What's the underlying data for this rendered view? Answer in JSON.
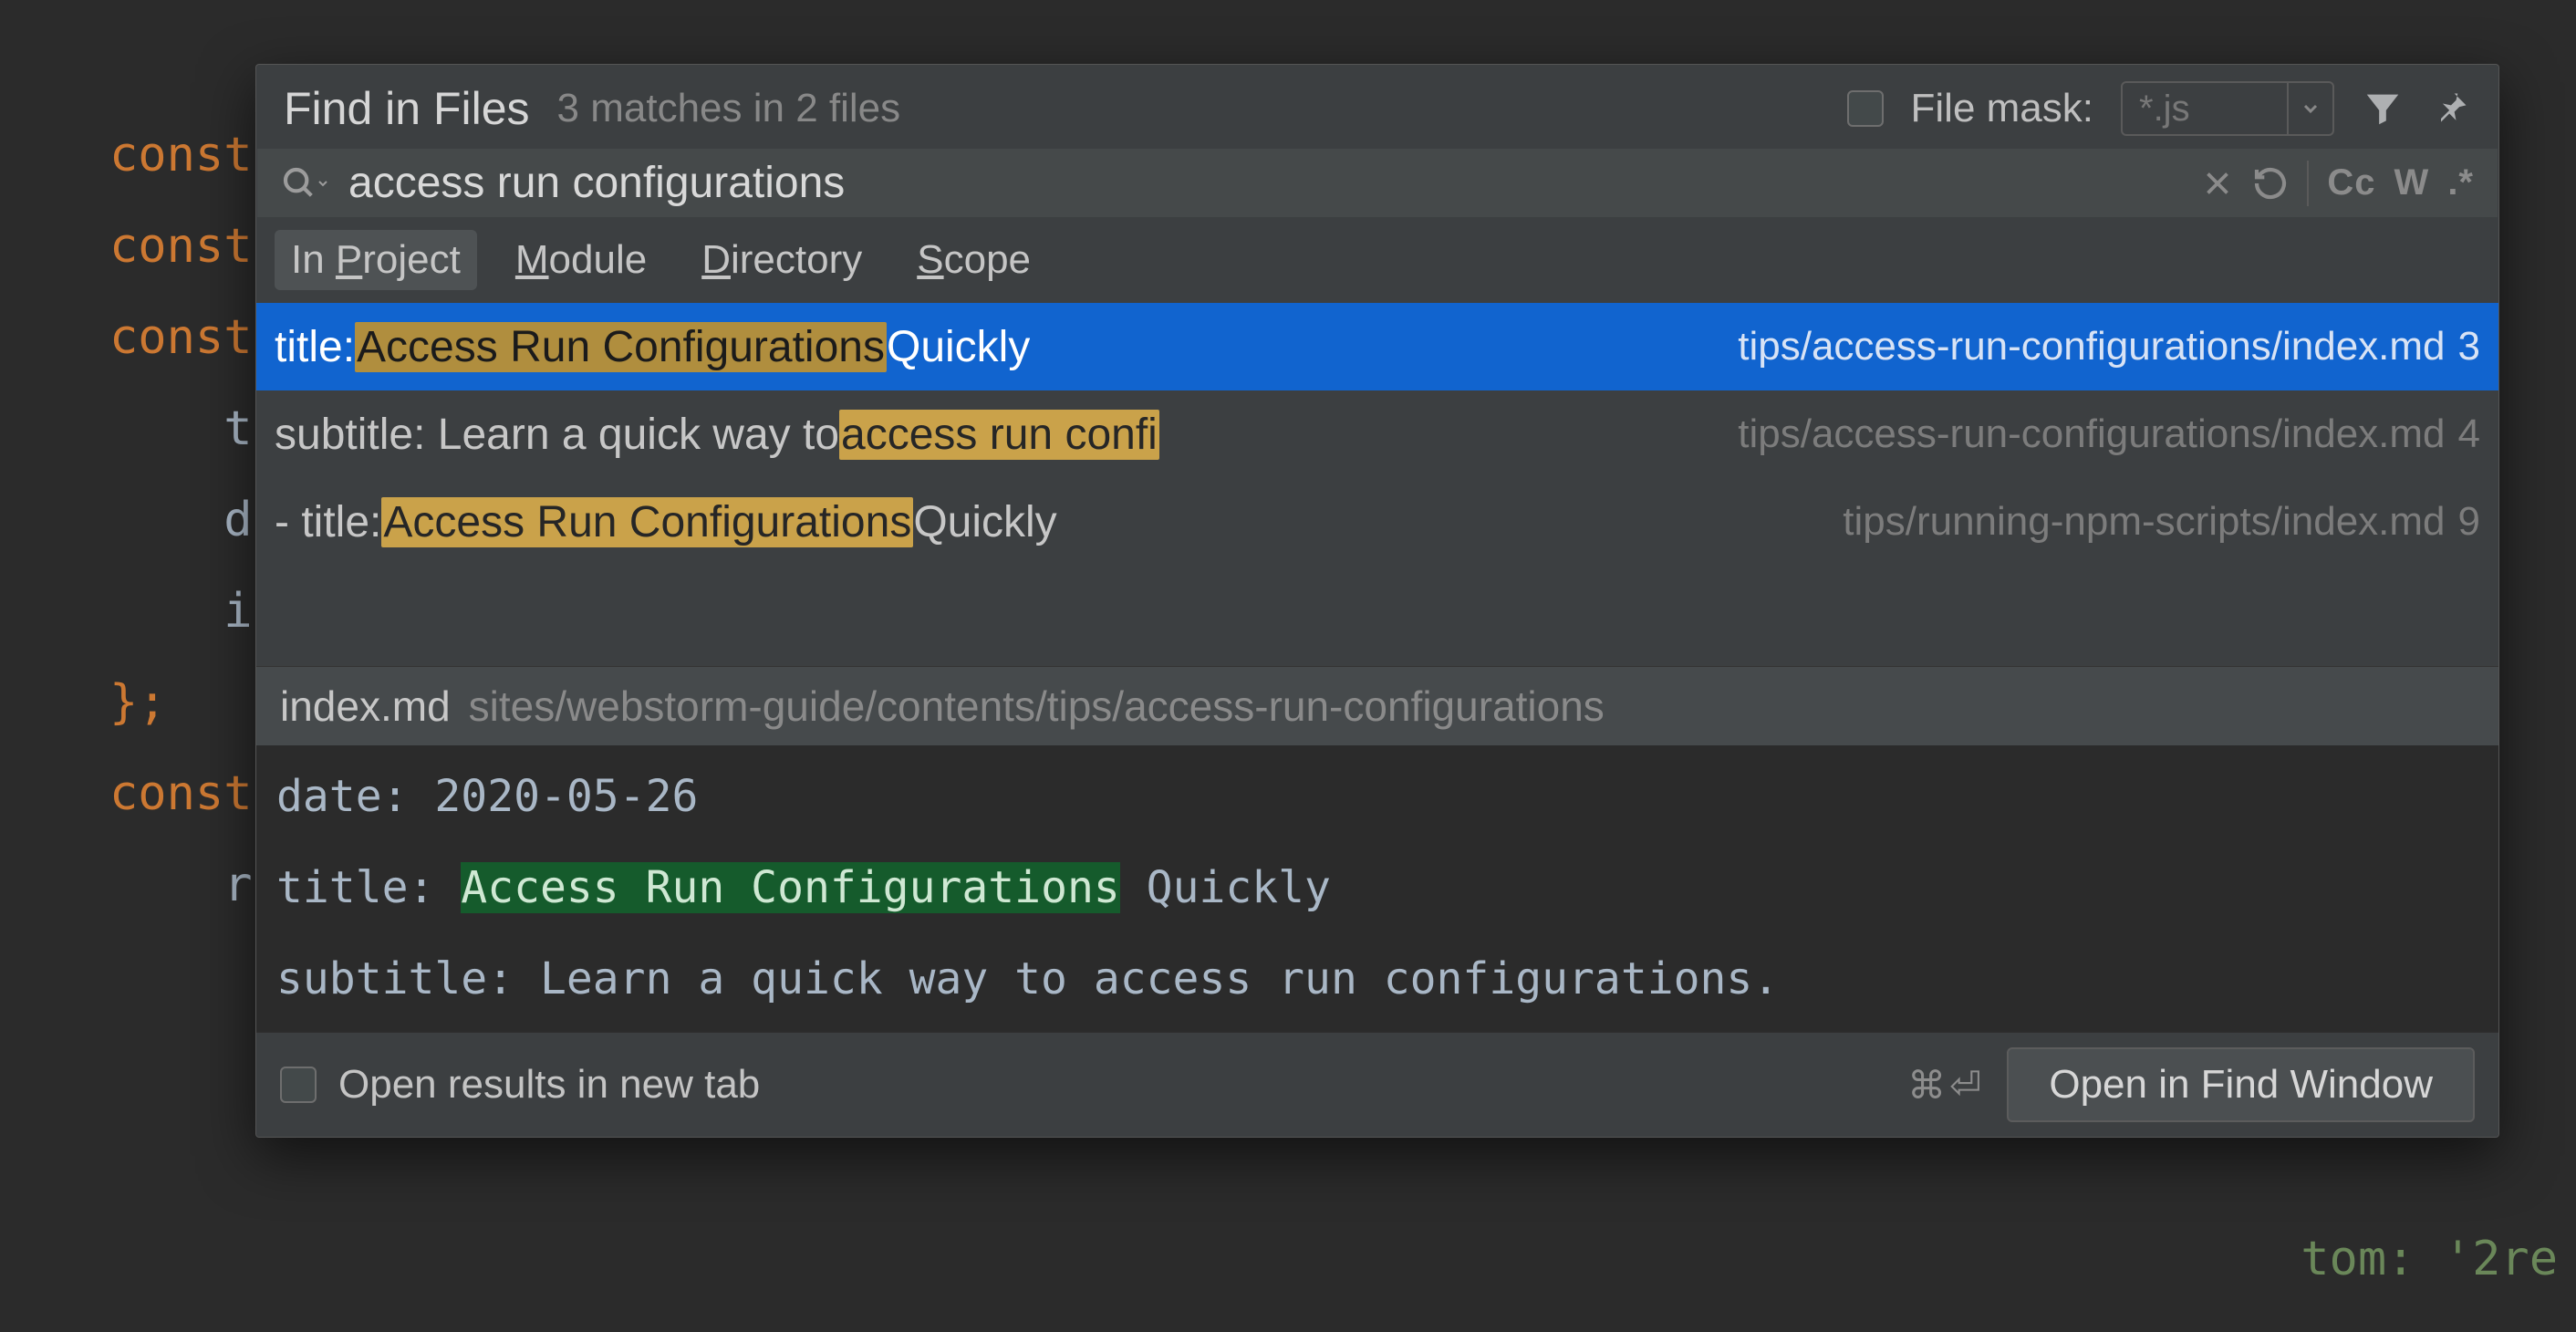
{
  "editor_bg": {
    "lines": [
      "const",
      "const",
      "",
      "const",
      "    t",
      "    d",
      "    i",
      "};",
      "",
      "const",
      "",
      "    r"
    ],
    "bottom_right_fragment": "tom: '2re"
  },
  "dialog": {
    "title": "Find in Files",
    "summary": "3 matches in 2 files",
    "file_mask_label": "File mask:",
    "file_mask_value": "*.js",
    "search_query": "access run configurations",
    "scope_tabs": [
      {
        "label": "In Project",
        "active": true,
        "mn": "P"
      },
      {
        "label": "Module",
        "active": false,
        "mn": "M"
      },
      {
        "label": "Directory",
        "active": false,
        "mn": "D"
      },
      {
        "label": "Scope",
        "active": false,
        "mn": "S"
      }
    ],
    "toolbar_labels": {
      "cc": "Cc",
      "w": "W",
      "regex": ".*"
    },
    "results": [
      {
        "selected": true,
        "prefix": "title: ",
        "highlight": "Access Run Configurations",
        "suffix": " Quickly",
        "path": "tips/access-run-configurations/index.md",
        "line": "3"
      },
      {
        "selected": false,
        "prefix": "subtitle: Learn a quick way to ",
        "highlight": "access run confi",
        "suffix": "",
        "path": "tips/access-run-configurations/index.md",
        "line": "4"
      },
      {
        "selected": false,
        "prefix": "- title: ",
        "highlight": "Access Run Configurations",
        "suffix": " Quickly",
        "path": "tips/running-npm-scripts/index.md",
        "line": "9"
      }
    ],
    "preview": {
      "file": "index.md",
      "path": "sites/webstorm-guide/contents/tips/access-run-configurations",
      "lines": {
        "l1": "date: 2020-05-26",
        "l2_prefix": "title: ",
        "l2_highlight": "Access Run Configurations",
        "l2_suffix": " Quickly",
        "l3": "subtitle: Learn a quick way to access run configurations."
      }
    },
    "footer": {
      "open_tab_label": "Open results in new tab",
      "shortcut": "⌘⏎",
      "open_button": "Open in Find Window"
    }
  }
}
